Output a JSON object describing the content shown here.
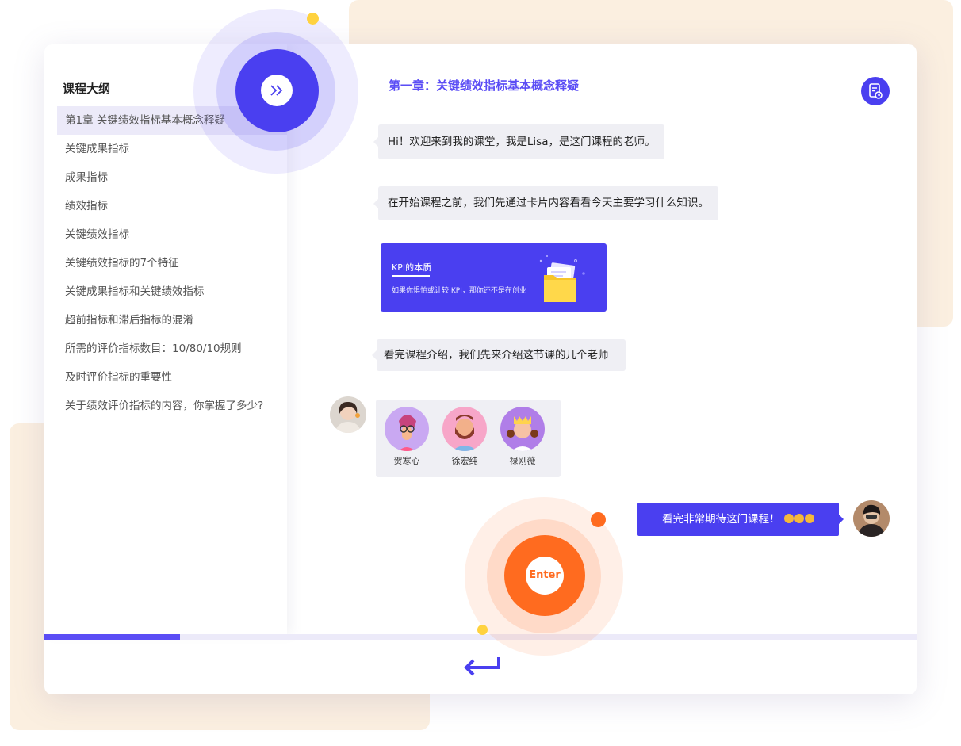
{
  "sidebar": {
    "title": "课程大纲",
    "items": [
      {
        "label": "第1章   关键绩效指标基本概念释疑",
        "active": true
      },
      {
        "label": "关键成果指标",
        "active": false
      },
      {
        "label": "成果指标",
        "active": false
      },
      {
        "label": "绩效指标",
        "active": false
      },
      {
        "label": "关键绩效指标",
        "active": false
      },
      {
        "label": "关键绩效指标的7个特征",
        "active": false
      },
      {
        "label": "关键成果指标和关键绩效指标",
        "active": false
      },
      {
        "label": "超前指标和滞后指标的混淆",
        "active": false
      },
      {
        "label": "所需的评价指标数目：10/80/10规则",
        "active": false
      },
      {
        "label": "及时评价指标的重要性",
        "active": false
      },
      {
        "label": "关于绩效评价指标的内容，你掌握了多少?",
        "active": false
      }
    ]
  },
  "main": {
    "chapter_title": "第一章：关键绩效指标基本概念释疑",
    "messages": [
      "Hi！欢迎来到我的课堂，我是Lisa，是这门课程的老师。",
      "在开始课程之前，我们先通过卡片内容看看今天主要学习什么知识。",
      "看完课程介绍，我们先来介绍这节课的几个老师"
    ],
    "kpi_card": {
      "title": "KPI的本质",
      "subtitle": "如果你惧怕或计较 KPI，那你还不是在创业"
    },
    "teachers": [
      {
        "name": "贺寒心"
      },
      {
        "name": "徐宏纯"
      },
      {
        "name": "禄刚薇"
      }
    ],
    "user_message": "看完非常期待这门课程！"
  },
  "enter_button": {
    "label": "Enter"
  },
  "progress": {
    "fraction": 0.155
  },
  "colors": {
    "accent": "#4a3ff0",
    "orange": "#ff6b1f",
    "peach_bg": "#fbefe0",
    "bubble_bg": "#efeff4",
    "yellow_dot": "#ffd23f"
  },
  "icons": {
    "skip": "double-chevron-right-icon",
    "doc": "document-refresh-icon",
    "enter": "return-arrow-icon",
    "folder": "folder-illustration"
  }
}
